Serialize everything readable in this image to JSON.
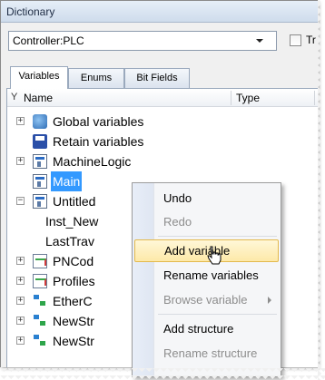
{
  "window": {
    "title": "Dictionary"
  },
  "controller": {
    "selected": "Controller:PLC",
    "checkbox_label": "Tr"
  },
  "tabs": [
    {
      "label": "Variables",
      "active": true
    },
    {
      "label": "Enums",
      "active": false
    },
    {
      "label": "Bit Fields",
      "active": false
    }
  ],
  "tree": {
    "columns": {
      "name": "Name",
      "type": "Type"
    },
    "rows": [
      {
        "label": "Global variables",
        "icon": "globe-icon",
        "expander": "+"
      },
      {
        "label": "Retain variables",
        "icon": "disk-icon",
        "expander": ""
      },
      {
        "label": "MachineLogic",
        "icon": "program-icon",
        "expander": "+"
      },
      {
        "label": "Main",
        "icon": "program-icon",
        "expander": "",
        "selected": true
      },
      {
        "label": "Untitled",
        "icon": "program-icon",
        "expander": "−"
      },
      {
        "label": "Inst_New",
        "icon": "",
        "expander": ""
      },
      {
        "label": "LastTrav",
        "icon": "",
        "expander": ""
      },
      {
        "label": "PNCod",
        "icon": "profile-icon",
        "expander": "+"
      },
      {
        "label": "Profiles",
        "icon": "profile-icon",
        "expander": "+"
      },
      {
        "label": "EtherC",
        "icon": "struct-icon",
        "expander": "+"
      },
      {
        "label": "NewStr",
        "icon": "struct-icon",
        "expander": "+"
      },
      {
        "label": "NewStr",
        "icon": "struct-icon",
        "expander": "+"
      }
    ]
  },
  "context_menu": {
    "items": [
      {
        "label": "Undo",
        "disabled": false
      },
      {
        "label": "Redo",
        "disabled": true
      },
      {
        "label": "Add variable",
        "disabled": false,
        "hover": true
      },
      {
        "label": "Rename variables",
        "disabled": false
      },
      {
        "label": "Browse variable",
        "disabled": true,
        "submenu": true
      },
      {
        "label": "Add structure",
        "disabled": false
      },
      {
        "label": "Rename structure",
        "disabled": true
      }
    ]
  },
  "colors": {
    "selection": "#3399ff",
    "menu_hover": "#fde9a8",
    "disabled_text": "#8d8d8d"
  }
}
